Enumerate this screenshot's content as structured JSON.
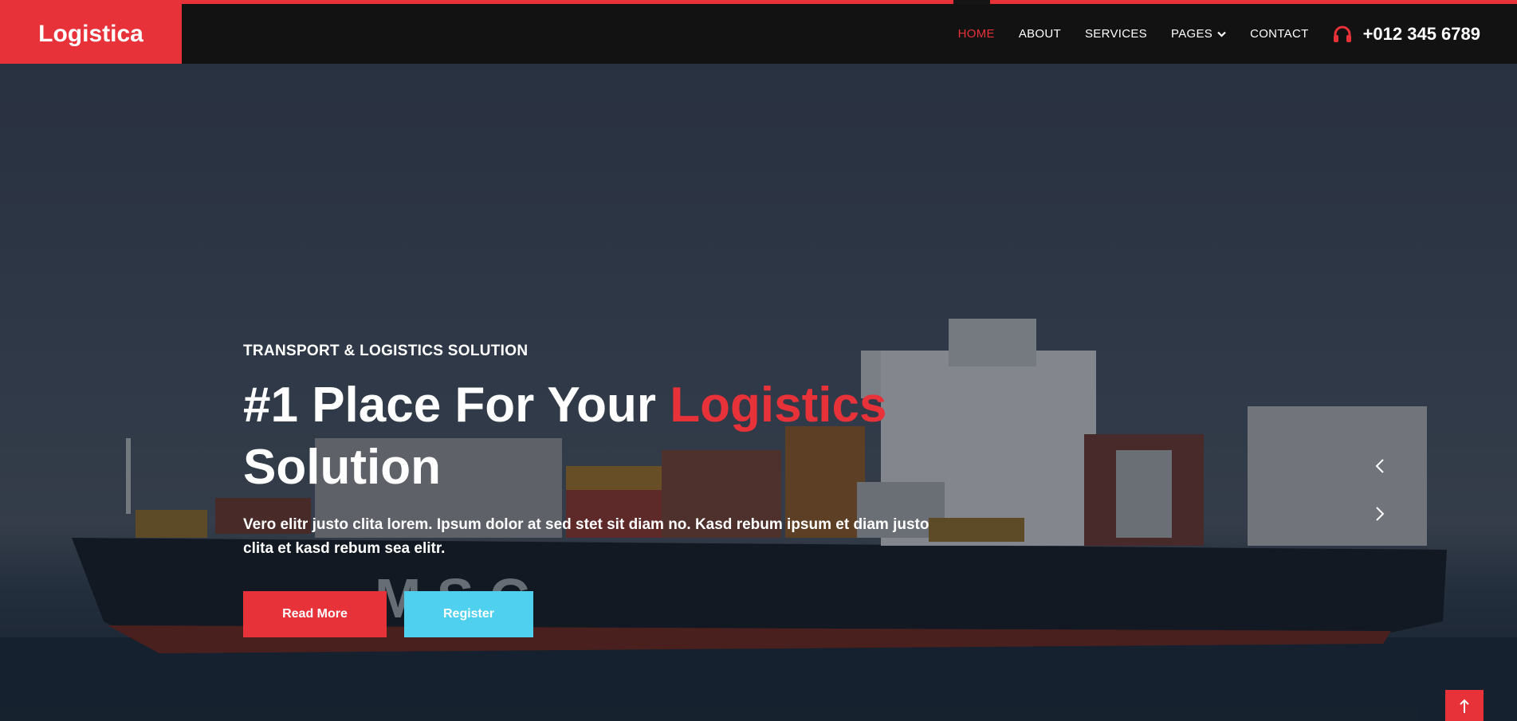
{
  "brand": "Logistica",
  "nav": {
    "items": [
      {
        "label": "HOME"
      },
      {
        "label": "ABOUT"
      },
      {
        "label": "SERVICES"
      },
      {
        "label": "PAGES"
      },
      {
        "label": "CONTACT"
      }
    ],
    "active_index": 0,
    "phone": "+012 345 6789"
  },
  "hero": {
    "kicker": "TRANSPORT & LOGISTICS SOLUTION",
    "title_part1": "#1 Place For Your ",
    "title_accent": "Logistics",
    "title_part2": "Solution",
    "description": "Vero elitr justo clita lorem. Ipsum dolor at sed stet sit diam no. Kasd rebum ipsum et diam justo clita et kasd rebum sea elitr.",
    "primary_button": "Read More",
    "secondary_button": "Register"
  },
  "icons": {
    "phone": "headphones-icon",
    "dropdown": "chevron-down-icon",
    "prev": "chevron-left-icon",
    "next": "chevron-right-icon",
    "back_to_top": "arrow-up-icon"
  },
  "colors": {
    "accent": "#e8323a",
    "info": "#4fd0ef",
    "navbar": "#121212"
  }
}
